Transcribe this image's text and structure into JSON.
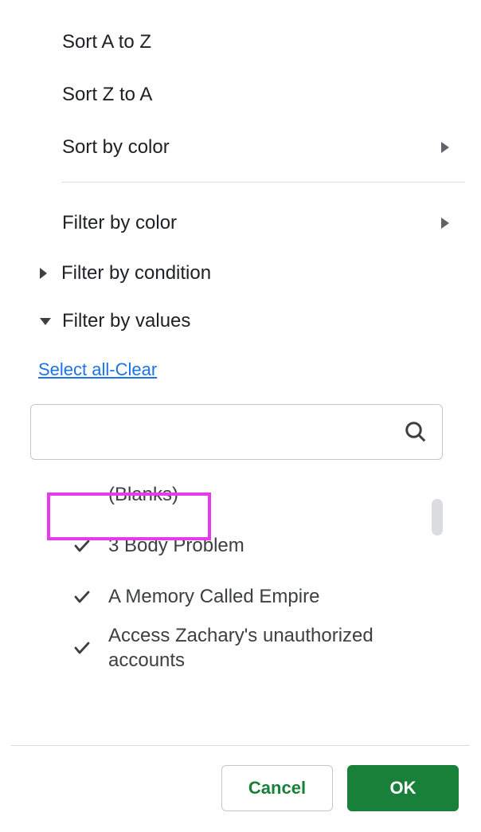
{
  "menu": {
    "sort_az": "Sort A to Z",
    "sort_za": "Sort Z to A",
    "sort_color": "Sort by color",
    "filter_color": "Filter by color",
    "filter_condition": "Filter by condition",
    "filter_values": "Filter by values"
  },
  "links": {
    "select_all": "Select all",
    "separator": "-",
    "clear": "Clear"
  },
  "search": {
    "value": "",
    "placeholder": ""
  },
  "values": [
    {
      "label": "(Blanks)",
      "checked": false
    },
    {
      "label": "3 Body Problem",
      "checked": true
    },
    {
      "label": "A Memory Called Empire",
      "checked": true
    },
    {
      "label": "Access Zachary's unauthorized accounts",
      "checked": true
    }
  ],
  "footer": {
    "cancel": "Cancel",
    "ok": "OK"
  }
}
